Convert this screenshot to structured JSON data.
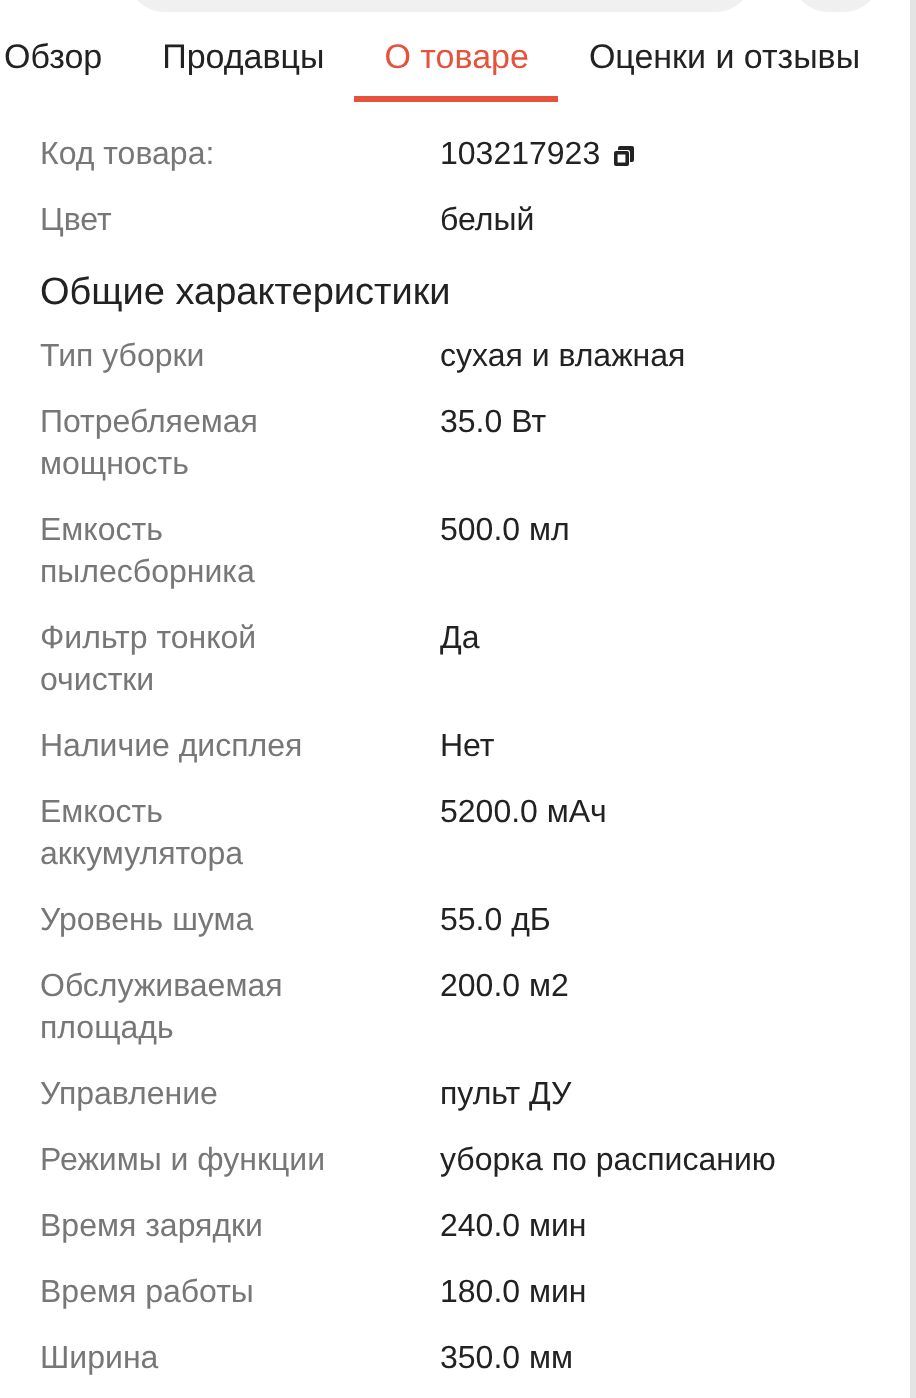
{
  "tabs": [
    {
      "label": "Обзор",
      "selected": false
    },
    {
      "label": "Продавцы",
      "selected": false
    },
    {
      "label": "О товаре",
      "selected": true
    },
    {
      "label": "Оценки и отзывы",
      "selected": false
    }
  ],
  "product_code": {
    "label": "Код товара:",
    "value": "103217923"
  },
  "color_row": {
    "label": "Цвет",
    "value": "белый"
  },
  "section_title": "Общие характеристики",
  "specs": [
    {
      "label": "Тип уборки",
      "value": "сухая и влажная"
    },
    {
      "label": "Потребляемая мощность",
      "value": "35.0 Вт"
    },
    {
      "label": "Емкость пылесборника",
      "value": "500.0 мл"
    },
    {
      "label": "Фильтр тонкой очистки",
      "value": "Да"
    },
    {
      "label": "Наличие дисплея",
      "value": "Нет"
    },
    {
      "label": "Емкость аккумулятора",
      "value": "5200.0 мАч"
    },
    {
      "label": "Уровень шума",
      "value": "55.0 дБ"
    },
    {
      "label": "Обслуживаемая площадь",
      "value": "200.0 м2"
    },
    {
      "label": "Управление",
      "value": "пульт ДУ"
    },
    {
      "label": "Режимы и функции",
      "value": "уборка по расписанию"
    },
    {
      "label": "Время зарядки",
      "value": "240.0 мин"
    },
    {
      "label": "Время работы",
      "value": "180.0 мин"
    },
    {
      "label": "Ширина",
      "value": "350.0 мм"
    }
  ]
}
